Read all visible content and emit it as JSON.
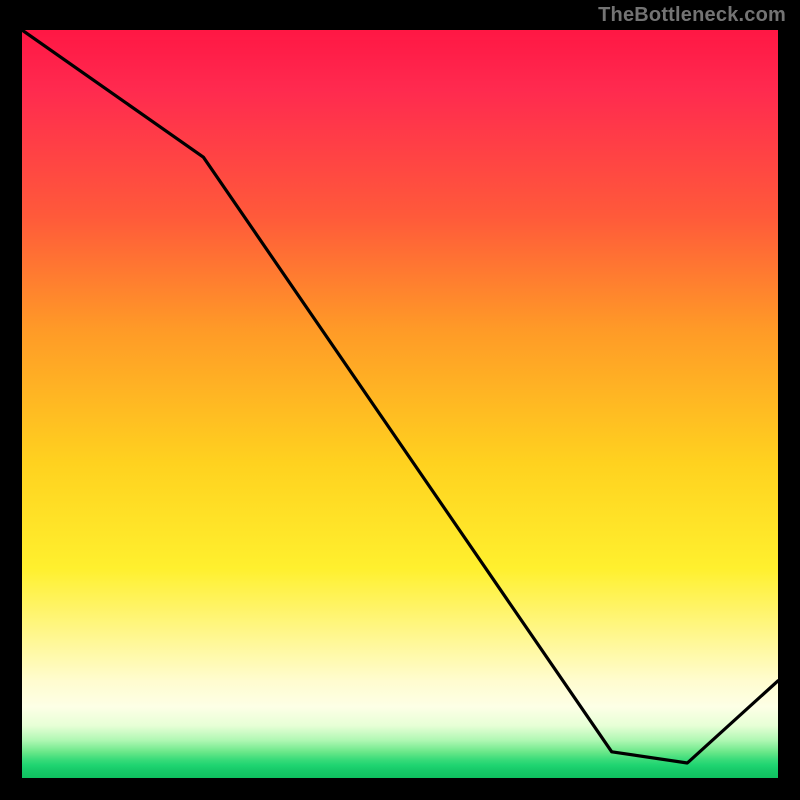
{
  "watermark": "TheBottleneck.com",
  "annotation": {
    "bar_label": ""
  },
  "colors": {
    "background": "#000000",
    "gradient_top": "#ff1744",
    "gradient_bottom": "#0fc05f",
    "curve": "#000000",
    "watermark": "#737373",
    "annotation": "#d23b3b"
  },
  "chart_data": {
    "type": "line",
    "title": "",
    "xlabel": "",
    "ylabel": "",
    "xlim": [
      0,
      100
    ],
    "ylim": [
      0,
      100
    ],
    "x": [
      0,
      24,
      78,
      88,
      100
    ],
    "values": [
      100,
      83,
      3.5,
      2,
      13
    ],
    "notes": "Single black curve over a vertical red→green gradient. Curve starts at top-left, has a slight elbow near x≈24, descends nearly linearly to a trough around x≈82–90 close to the bottom, then rises toward the right edge. A small red bar-like annotation sits along the trough."
  }
}
